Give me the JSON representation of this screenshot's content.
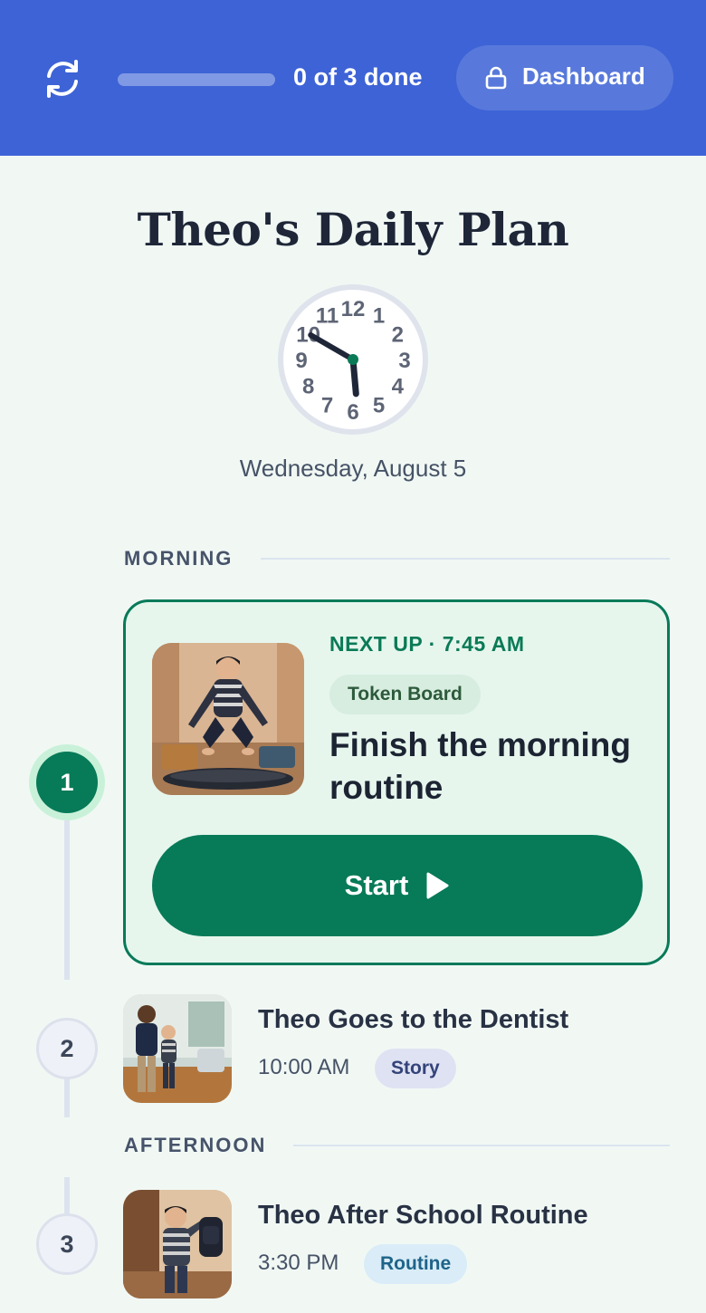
{
  "header": {
    "refresh_icon": "refresh-icon",
    "progress_fraction": 0,
    "progress_text": "0 of 3 done",
    "dashboard_label": "Dashboard",
    "lock_icon": "lock-icon",
    "background": "#3d63d6"
  },
  "page": {
    "title": "Theo's Daily Plan",
    "date": "Wednesday, August 5",
    "clock": {
      "numbers": [
        "12",
        "1",
        "2",
        "3",
        "4",
        "5",
        "6",
        "7",
        "8",
        "9",
        "10",
        "11"
      ],
      "hour": 5,
      "minute": 50
    }
  },
  "sections": {
    "morning": "MORNING",
    "afternoon": "AFTERNOON"
  },
  "featured": {
    "step": "1",
    "next_up": "NEXT UP · 7:45 AM",
    "badge": "Token Board",
    "title": "Finish the morning routine",
    "start_label": "Start",
    "play_icon": "play-icon",
    "accent": "#077a58"
  },
  "items": [
    {
      "step": "2",
      "title": "Theo Goes to the Dentist",
      "time": "10:00 AM",
      "badge": "Story"
    },
    {
      "step": "3",
      "title": "Theo After School Routine",
      "time": "3:30 PM",
      "badge": "Routine"
    }
  ]
}
